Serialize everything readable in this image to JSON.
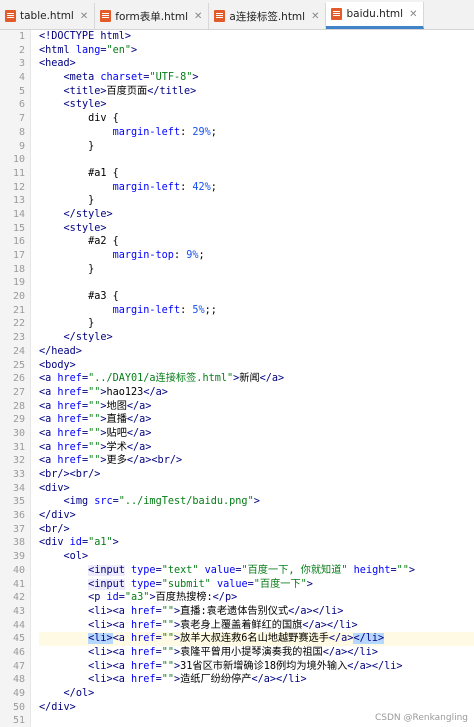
{
  "tabs": [
    {
      "label": "table.html",
      "active": false
    },
    {
      "label": "form表单.html",
      "active": false
    },
    {
      "label": "a连接标签.html",
      "active": false
    },
    {
      "label": "baidu.html",
      "active": true
    }
  ],
  "line_numbers": [
    "1",
    "2",
    "3",
    "4",
    "5",
    "6",
    "7",
    "8",
    "9",
    "10",
    "11",
    "12",
    "13",
    "14",
    "15",
    "16",
    "17",
    "18",
    "19",
    "20",
    "21",
    "22",
    "23",
    "24",
    "25",
    "26",
    "27",
    "28",
    "29",
    "30",
    "31",
    "32",
    "33",
    "34",
    "35",
    "36",
    "37",
    "38",
    "39",
    "40",
    "41",
    "42",
    "43",
    "44",
    "45",
    "46",
    "47",
    "48",
    "49",
    "50",
    "51"
  ],
  "watermark": "CSDN @Renkangling",
  "code_lines": [
    {
      "t": [
        [
          "tag",
          "<!DOCTYPE html>"
        ]
      ]
    },
    {
      "t": [
        [
          "tag",
          "<html "
        ],
        [
          "attr",
          "lang"
        ],
        [
          "tag",
          "="
        ],
        [
          "str",
          "\"en\""
        ],
        [
          "tag",
          ">"
        ]
      ]
    },
    {
      "t": [
        [
          "tag",
          "<head>"
        ]
      ]
    },
    {
      "t": [
        [
          "text",
          "    "
        ],
        [
          "tag",
          "<meta "
        ],
        [
          "attr",
          "charset"
        ],
        [
          "tag",
          "="
        ],
        [
          "str",
          "\"UTF-8\""
        ],
        [
          "tag",
          ">"
        ]
      ]
    },
    {
      "t": [
        [
          "text",
          "    "
        ],
        [
          "tag",
          "<title>"
        ],
        [
          "text",
          "百度页面"
        ],
        [
          "tag",
          "</title>"
        ]
      ]
    },
    {
      "t": [
        [
          "text",
          "    "
        ],
        [
          "tag",
          "<style>"
        ]
      ]
    },
    {
      "t": [
        [
          "text",
          "        div {"
        ]
      ]
    },
    {
      "t": [
        [
          "text",
          "            "
        ],
        [
          "prop",
          "margin-left"
        ],
        [
          "text",
          ": "
        ],
        [
          "num",
          "29%"
        ],
        [
          "text",
          ";"
        ]
      ]
    },
    {
      "t": [
        [
          "text",
          "        }"
        ]
      ]
    },
    {
      "t": [
        [
          "text",
          ""
        ]
      ]
    },
    {
      "t": [
        [
          "text",
          "        #a1 {"
        ]
      ]
    },
    {
      "t": [
        [
          "text",
          "            "
        ],
        [
          "prop",
          "margin-left"
        ],
        [
          "text",
          ": "
        ],
        [
          "num",
          "42%"
        ],
        [
          "text",
          ";"
        ]
      ]
    },
    {
      "t": [
        [
          "text",
          "        }"
        ]
      ]
    },
    {
      "t": [
        [
          "text",
          "    "
        ],
        [
          "tag",
          "</style>"
        ]
      ]
    },
    {
      "t": [
        [
          "text",
          "    "
        ],
        [
          "tag",
          "<style>"
        ]
      ]
    },
    {
      "t": [
        [
          "text",
          "        #a2 {"
        ]
      ]
    },
    {
      "t": [
        [
          "text",
          "            "
        ],
        [
          "prop",
          "margin-top"
        ],
        [
          "text",
          ": "
        ],
        [
          "num",
          "9%"
        ],
        [
          "text",
          ";"
        ]
      ]
    },
    {
      "t": [
        [
          "text",
          "        }"
        ]
      ]
    },
    {
      "t": [
        [
          "text",
          ""
        ]
      ]
    },
    {
      "t": [
        [
          "text",
          "        #a3 {"
        ]
      ]
    },
    {
      "t": [
        [
          "text",
          "            "
        ],
        [
          "prop",
          "margin-left"
        ],
        [
          "text",
          ": "
        ],
        [
          "num",
          "5%"
        ],
        [
          "text",
          ";;"
        ]
      ]
    },
    {
      "t": [
        [
          "text",
          "        }"
        ]
      ]
    },
    {
      "t": [
        [
          "text",
          "    "
        ],
        [
          "tag",
          "</style>"
        ]
      ]
    },
    {
      "t": [
        [
          "tag",
          "</head>"
        ]
      ]
    },
    {
      "t": [
        [
          "tag",
          "<body>"
        ]
      ]
    },
    {
      "t": [
        [
          "tag",
          "<a "
        ],
        [
          "attr",
          "href"
        ],
        [
          "tag",
          "="
        ],
        [
          "str",
          "\"../DAY01/a连接标签.html\""
        ],
        [
          "tag",
          ">"
        ],
        [
          "text",
          "新闻"
        ],
        [
          "tag",
          "</a>"
        ]
      ]
    },
    {
      "t": [
        [
          "tag",
          "<a "
        ],
        [
          "attr",
          "href"
        ],
        [
          "tag",
          "="
        ],
        [
          "str",
          "\"\""
        ],
        [
          "tag",
          ">"
        ],
        [
          "text",
          "hao123"
        ],
        [
          "tag",
          "</a>"
        ]
      ]
    },
    {
      "t": [
        [
          "tag",
          "<a "
        ],
        [
          "attr",
          "href"
        ],
        [
          "tag",
          "="
        ],
        [
          "str",
          "\"\""
        ],
        [
          "tag",
          ">"
        ],
        [
          "text",
          "地图"
        ],
        [
          "tag",
          "</a>"
        ]
      ]
    },
    {
      "t": [
        [
          "tag",
          "<a "
        ],
        [
          "attr",
          "href"
        ],
        [
          "tag",
          "="
        ],
        [
          "str",
          "\"\""
        ],
        [
          "tag",
          ">"
        ],
        [
          "text",
          "直播"
        ],
        [
          "tag",
          "</a>"
        ]
      ]
    },
    {
      "t": [
        [
          "tag",
          "<a "
        ],
        [
          "attr",
          "href"
        ],
        [
          "tag",
          "="
        ],
        [
          "str",
          "\"\""
        ],
        [
          "tag",
          ">"
        ],
        [
          "text",
          "贴吧"
        ],
        [
          "tag",
          "</a>"
        ]
      ]
    },
    {
      "t": [
        [
          "tag",
          "<a "
        ],
        [
          "attr",
          "href"
        ],
        [
          "tag",
          "="
        ],
        [
          "str",
          "\"\""
        ],
        [
          "tag",
          ">"
        ],
        [
          "text",
          "学术"
        ],
        [
          "tag",
          "</a>"
        ]
      ]
    },
    {
      "t": [
        [
          "tag",
          "<a "
        ],
        [
          "attr",
          "href"
        ],
        [
          "tag",
          "="
        ],
        [
          "str",
          "\"\""
        ],
        [
          "tag",
          ">"
        ],
        [
          "text",
          "更多"
        ],
        [
          "tag",
          "</a><br/>"
        ]
      ]
    },
    {
      "t": [
        [
          "tag",
          "<br/><br/>"
        ]
      ]
    },
    {
      "t": [
        [
          "tag",
          "<div>"
        ]
      ]
    },
    {
      "t": [
        [
          "text",
          "    "
        ],
        [
          "tag",
          "<img "
        ],
        [
          "attr",
          "src"
        ],
        [
          "tag",
          "="
        ],
        [
          "str",
          "\"../imgTest/baidu.png\""
        ],
        [
          "tag",
          ">"
        ]
      ]
    },
    {
      "t": [
        [
          "tag",
          "</div>"
        ]
      ]
    },
    {
      "t": [
        [
          "tag",
          "<br/>"
        ]
      ]
    },
    {
      "t": [
        [
          "tag",
          "<div "
        ],
        [
          "attr",
          "id"
        ],
        [
          "tag",
          "="
        ],
        [
          "str",
          "\"a1\""
        ],
        [
          "tag",
          ">"
        ]
      ]
    },
    {
      "t": [
        [
          "text",
          "    "
        ],
        [
          "tag",
          "<ol>"
        ]
      ]
    },
    {
      "t": [
        [
          "text",
          "        "
        ],
        [
          "hl",
          "<input"
        ],
        [
          "tag",
          " "
        ],
        [
          "attr",
          "type"
        ],
        [
          "tag",
          "="
        ],
        [
          "str",
          "\"text\""
        ],
        [
          "tag",
          " "
        ],
        [
          "attr",
          "value"
        ],
        [
          "tag",
          "="
        ],
        [
          "str",
          "\"百度一下, 你就知道\""
        ],
        [
          "tag",
          " "
        ],
        [
          "attr",
          "height"
        ],
        [
          "tag",
          "="
        ],
        [
          "str",
          "\"\""
        ],
        [
          "tag",
          ">"
        ]
      ]
    },
    {
      "t": [
        [
          "text",
          "        "
        ],
        [
          "hl",
          "<input"
        ],
        [
          "tag",
          " "
        ],
        [
          "attr",
          "type"
        ],
        [
          "tag",
          "="
        ],
        [
          "str",
          "\"submit\""
        ],
        [
          "tag",
          " "
        ],
        [
          "attr",
          "value"
        ],
        [
          "tag",
          "="
        ],
        [
          "str",
          "\"百度一下\""
        ],
        [
          "tag",
          ">"
        ]
      ]
    },
    {
      "t": [
        [
          "text",
          "        "
        ],
        [
          "tag",
          "<p "
        ],
        [
          "attr",
          "id"
        ],
        [
          "tag",
          "="
        ],
        [
          "str",
          "\"a3\""
        ],
        [
          "tag",
          ">"
        ],
        [
          "text",
          "百度热搜榜:"
        ],
        [
          "tag",
          "</p>"
        ]
      ]
    },
    {
      "t": [
        [
          "text",
          "        "
        ],
        [
          "tag",
          "<li><a "
        ],
        [
          "attr",
          "href"
        ],
        [
          "tag",
          "="
        ],
        [
          "str",
          "\"\""
        ],
        [
          "tag",
          ">"
        ],
        [
          "text",
          "直播:袁老遗体告别仪式"
        ],
        [
          "tag",
          "</a></li>"
        ]
      ]
    },
    {
      "t": [
        [
          "text",
          "        "
        ],
        [
          "tag",
          "<li><a "
        ],
        [
          "attr",
          "href"
        ],
        [
          "tag",
          "="
        ],
        [
          "str",
          "\"\""
        ],
        [
          "tag",
          ">"
        ],
        [
          "text",
          "袁老身上覆盖着鲜红的国旗"
        ],
        [
          "tag",
          "</a></li>"
        ]
      ]
    },
    {
      "cur": true,
      "t": [
        [
          "text",
          "        "
        ],
        [
          "hlb",
          "<li>"
        ],
        [
          "tag",
          "<a "
        ],
        [
          "attr",
          "href"
        ],
        [
          "tag",
          "="
        ],
        [
          "str",
          "\"\""
        ],
        [
          "tag",
          ">"
        ],
        [
          "text",
          "放羊大叔连救6名山地越野赛选手"
        ],
        [
          "tag",
          "</a>"
        ],
        [
          "hlb",
          "</li>"
        ]
      ]
    },
    {
      "t": [
        [
          "text",
          "        "
        ],
        [
          "tag",
          "<li><a "
        ],
        [
          "attr",
          "href"
        ],
        [
          "tag",
          "="
        ],
        [
          "str",
          "\"\""
        ],
        [
          "tag",
          ">"
        ],
        [
          "text",
          "袁隆平曾用小提琴演奏我的祖国"
        ],
        [
          "tag",
          "</a></li>"
        ]
      ]
    },
    {
      "t": [
        [
          "text",
          "        "
        ],
        [
          "tag",
          "<li><a "
        ],
        [
          "attr",
          "href"
        ],
        [
          "tag",
          "="
        ],
        [
          "str",
          "\"\""
        ],
        [
          "tag",
          ">"
        ],
        [
          "text",
          "31省区市新增确诊18例均为境外输入"
        ],
        [
          "tag",
          "</a></li>"
        ]
      ]
    },
    {
      "t": [
        [
          "text",
          "        "
        ],
        [
          "tag",
          "<li><a "
        ],
        [
          "attr",
          "href"
        ],
        [
          "tag",
          "="
        ],
        [
          "str",
          "\"\""
        ],
        [
          "tag",
          ">"
        ],
        [
          "text",
          "造纸厂纷纷停产"
        ],
        [
          "tag",
          "</a></li>"
        ]
      ]
    },
    {
      "t": [
        [
          "text",
          "    "
        ],
        [
          "tag",
          "</ol>"
        ]
      ]
    },
    {
      "t": [
        [
          "tag",
          "</div>"
        ]
      ]
    },
    {
      "t": [
        [
          "text",
          ""
        ]
      ]
    }
  ]
}
